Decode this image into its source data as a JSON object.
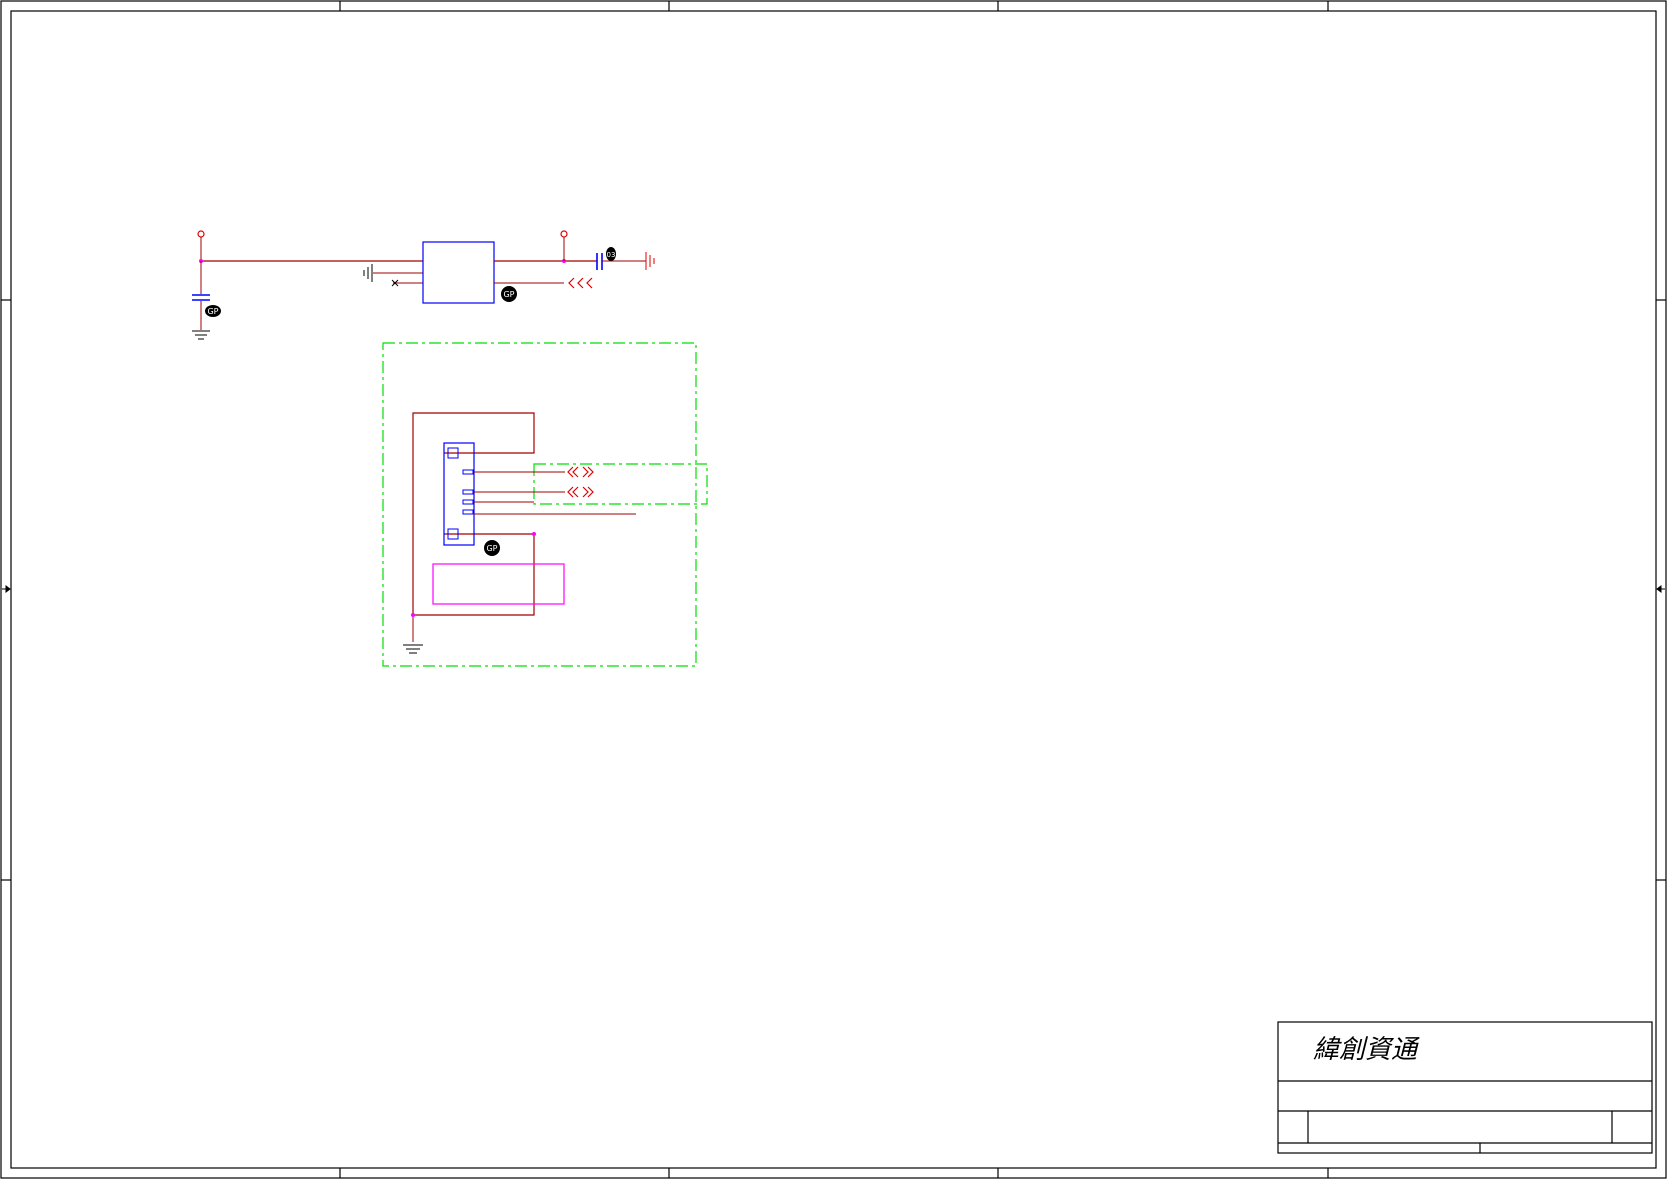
{
  "title_block": {
    "company_name": "緯創資通"
  },
  "badges": {
    "gp": "GP",
    "cap_marker": "03"
  },
  "colors": {
    "border": "#000000",
    "net_wire": "#a00000",
    "power_symbol": "#e00000",
    "component": "#0000ff",
    "junction": "#ff00ff",
    "keepout_region": "#00e000",
    "note_box": "#ff00ff"
  },
  "symbols": {
    "connector_pins": 6,
    "signal_arrows": [
      "double-chevron",
      "double-chevron"
    ]
  }
}
